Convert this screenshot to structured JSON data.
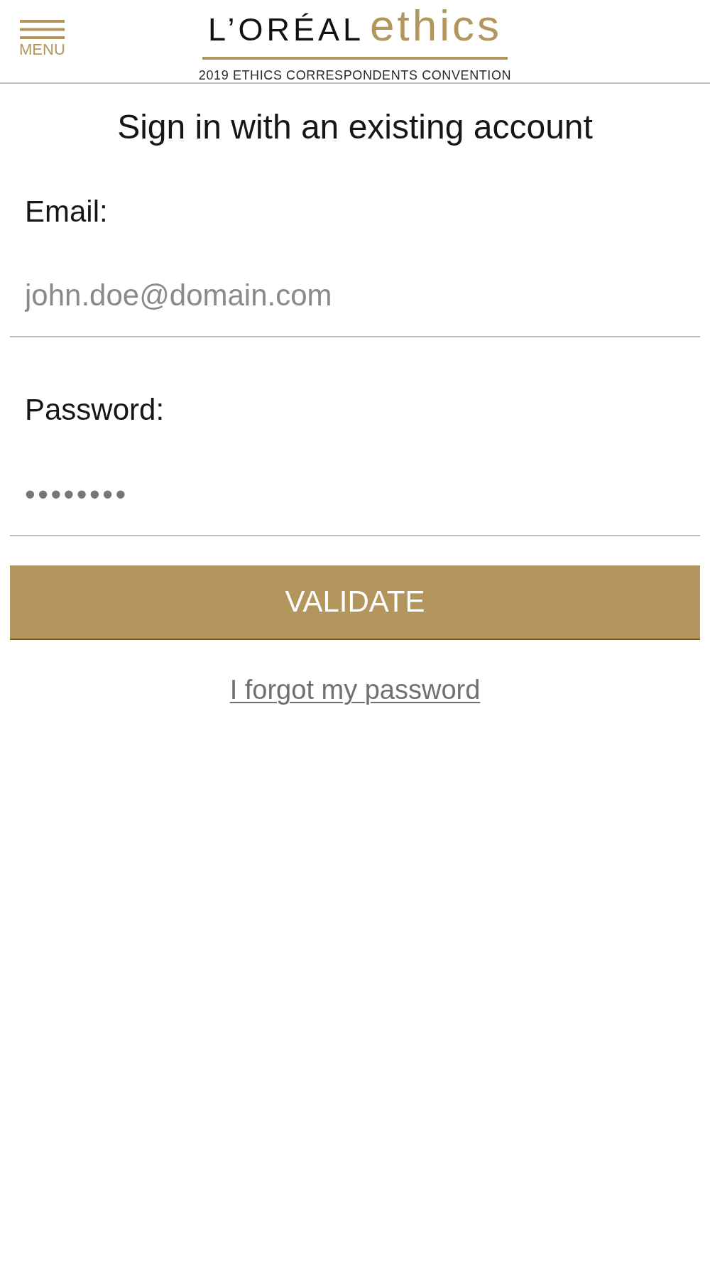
{
  "header": {
    "menu_button": {
      "label": "MENU"
    },
    "logo": {
      "brand": "L’ORÉAL",
      "word": "ethics",
      "subtitle": "2019 ETHICS CORRESPONDENTS CONVENTION"
    }
  },
  "form": {
    "title": "Sign in with an existing account",
    "fields": [
      {
        "kind": "email",
        "label": "Email:",
        "placeholder": "john.doe@domain.com"
      },
      {
        "kind": "password",
        "label": "Password:",
        "value": "••••••••"
      }
    ],
    "submit_button": {
      "label": "VALIDATE"
    },
    "forgot_link": {
      "label": "I forgot my password"
    }
  }
}
